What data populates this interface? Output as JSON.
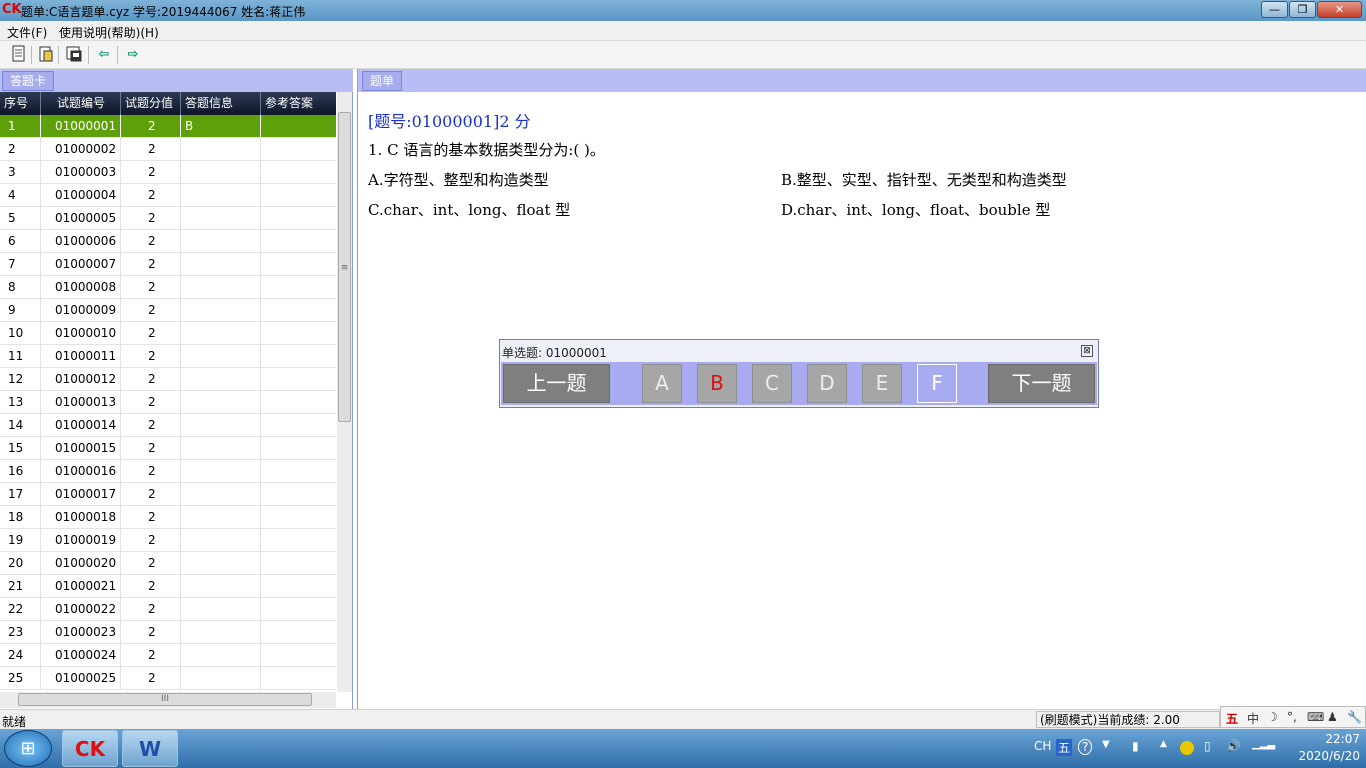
{
  "window": {
    "logo": "CK",
    "title": "题单:C语言题单.cyz  学号:2019444067 姓名:蒋正伟",
    "buttons": {
      "minimize": "—",
      "maximize": "❐",
      "close": "✕"
    }
  },
  "menu": {
    "file": "文件(F)",
    "help": "使用说明(帮助)(H)"
  },
  "toolbar": {
    "icons": [
      "new-document-icon",
      "open-document-icon",
      "save-icon",
      "arrow-left-icon",
      "arrow-right-icon"
    ],
    "prev_glyph": "⇦",
    "next_glyph": "⇨"
  },
  "left_tab": "答题卡",
  "grid": {
    "headers": [
      "序号",
      "试题编号",
      "试题分值",
      "答题信息",
      "参考答案"
    ],
    "rows": [
      [
        "1",
        "01000001",
        "2",
        "B",
        ""
      ],
      [
        "2",
        "01000002",
        "2",
        "",
        ""
      ],
      [
        "3",
        "01000003",
        "2",
        "",
        ""
      ],
      [
        "4",
        "01000004",
        "2",
        "",
        ""
      ],
      [
        "5",
        "01000005",
        "2",
        "",
        ""
      ],
      [
        "6",
        "01000006",
        "2",
        "",
        ""
      ],
      [
        "7",
        "01000007",
        "2",
        "",
        ""
      ],
      [
        "8",
        "01000008",
        "2",
        "",
        ""
      ],
      [
        "9",
        "01000009",
        "2",
        "",
        ""
      ],
      [
        "10",
        "01000010",
        "2",
        "",
        ""
      ],
      [
        "11",
        "01000011",
        "2",
        "",
        ""
      ],
      [
        "12",
        "01000012",
        "2",
        "",
        ""
      ],
      [
        "13",
        "01000013",
        "2",
        "",
        ""
      ],
      [
        "14",
        "01000014",
        "2",
        "",
        ""
      ],
      [
        "15",
        "01000015",
        "2",
        "",
        ""
      ],
      [
        "16",
        "01000016",
        "2",
        "",
        ""
      ],
      [
        "17",
        "01000017",
        "2",
        "",
        ""
      ],
      [
        "18",
        "01000018",
        "2",
        "",
        ""
      ],
      [
        "19",
        "01000019",
        "2",
        "",
        ""
      ],
      [
        "20",
        "01000020",
        "2",
        "",
        ""
      ],
      [
        "21",
        "01000021",
        "2",
        "",
        ""
      ],
      [
        "22",
        "01000022",
        "2",
        "",
        ""
      ],
      [
        "23",
        "01000023",
        "2",
        "",
        ""
      ],
      [
        "24",
        "01000024",
        "2",
        "",
        ""
      ],
      [
        "25",
        "01000025",
        "2",
        "",
        ""
      ]
    ],
    "selected_row": 0,
    "vscroll_glyph": "≡",
    "hscroll_glyph": "III"
  },
  "right_tab": "题单",
  "question": {
    "header": "[题号:01000001]2 分",
    "stem": "1. C 语言的基本数据类型分为:(        )。",
    "options": {
      "A": "A.字符型、整型和构造类型",
      "B": "B.整型、实型、指针型、无类型和构造类型",
      "C": "C.char、int、long、float 型",
      "D": "D.char、int、long、float、bouble 型"
    }
  },
  "answer_dialog": {
    "caption": "单选题: 01000001",
    "close": "⊠",
    "prev": "上一题",
    "next": "下一题",
    "options": [
      "A",
      "B",
      "C",
      "D",
      "E",
      "F"
    ],
    "selected": "B",
    "current_focus": "F"
  },
  "status": {
    "left": "就绪",
    "score": "(刷题模式)当前成绩: 2.00"
  },
  "ime": {
    "mode": "五",
    "lang": "中",
    "moon": "☽",
    "dots": "°,",
    "kbd": "⌨",
    "user": "♟",
    "wrench": "🔧"
  },
  "taskbar": {
    "start": "⊞",
    "items": [
      "CK",
      "W"
    ],
    "tray": {
      "lang": "CH",
      "ime": "五",
      "help": "?",
      "up": "▲"
    },
    "time": "22:07",
    "date": "2020/6/20"
  }
}
